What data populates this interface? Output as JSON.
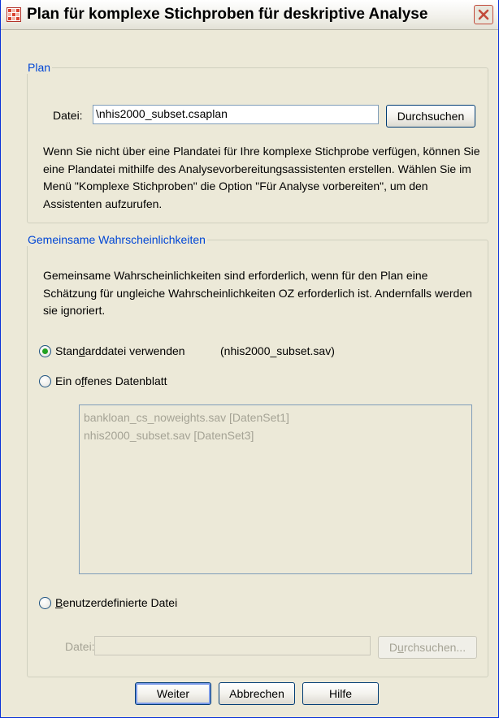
{
  "window": {
    "title": "Plan für komplexe Stichproben für deskriptive Analyse"
  },
  "plan": {
    "legend": "Plan",
    "file_label": "Datei:",
    "file_value": "\\nhis2000_subset.csaplan",
    "browse_label": "Durchsuchen",
    "description": "Wenn Sie nicht über eine Plandatei für Ihre komplexe Stichprobe verfügen, können Sie eine Plandatei mithilfe des Analysevorbereitungsassistenten erstellen. Wählen Sie im Menü \"Komplexe Stichproben\" die Option \"Für Analyse vorbereiten\", um den Assistenten aufzurufen."
  },
  "joint": {
    "legend": "Gemeinsame Wahrscheinlichkeiten",
    "description": "Gemeinsame Wahrscheinlichkeiten sind erforderlich, wenn für den Plan eine Schätzung für ungleiche Wahrscheinlichkeiten OZ erforderlich ist. Andernfalls werden sie ignoriert.",
    "options": [
      {
        "label_pre": "Stan",
        "label_mn": "d",
        "label_post": "arddatei verwenden",
        "checked": true
      },
      {
        "label_pre": "Ein o",
        "label_mn": "f",
        "label_post": "fenes Datenblatt",
        "checked": false
      },
      {
        "label_pre": "",
        "label_mn": "B",
        "label_post": "enutzerdefinierte Datei",
        "checked": false
      }
    ],
    "default_file": "(nhis2000_subset.sav)",
    "datasets": [
      "bankloan_cs_noweights.sav [DatenSet1]",
      "nhis2000_subset.sav [DatenSet3]"
    ],
    "custom_file_label": "Datei:",
    "custom_file_value": "",
    "browse_pre": "D",
    "browse_mn": "u",
    "browse_post": "rchsuchen..."
  },
  "buttons": {
    "continue": "Weiter",
    "cancel": "Abbrechen",
    "help": "Hilfe"
  },
  "colors": {
    "legend_text": "#0046d5",
    "radio_dot": "#21a121",
    "close_button": "#c24a3b"
  }
}
